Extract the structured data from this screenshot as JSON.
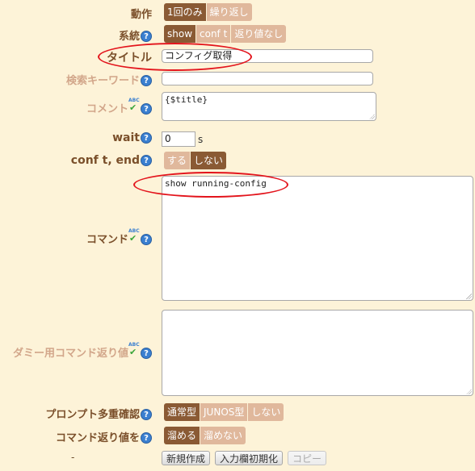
{
  "rows": {
    "action": {
      "label": "動作",
      "options": [
        "1回のみ",
        "繰り返し"
      ]
    },
    "system": {
      "label": "系統",
      "options": [
        "show",
        "conf t",
        "返り値なし"
      ]
    },
    "title": {
      "label": "タイトル",
      "value": "コンフィグ取得"
    },
    "search_keyword": {
      "label": "検索キーワード",
      "value": ""
    },
    "comment": {
      "label": "コメント",
      "value": "{$title}"
    },
    "wait": {
      "label": "wait",
      "value": "0",
      "unit": "s"
    },
    "conf_t_end": {
      "label": "conf t, end",
      "options": [
        "する",
        "しない"
      ]
    },
    "command": {
      "label": "コマンド",
      "value": "show running-config"
    },
    "dummy_return": {
      "label": "ダミー用コマンド返り値",
      "value": ""
    },
    "prompt_multi": {
      "label": "プロンプト多重確認",
      "options": [
        "通常型",
        "JUNOS型",
        "しない"
      ]
    },
    "command_return": {
      "label": "コマンド返り値を",
      "options": [
        "溜める",
        "溜めない"
      ]
    },
    "footer": {
      "label": "-",
      "buttons": [
        "新規作成",
        "入力欄初期化",
        "コピー"
      ]
    }
  },
  "icons": {
    "help": "?",
    "spellcheck_abc": "ABC",
    "spellcheck_check": "✔"
  },
  "colors": {
    "background": "#fdf3d8",
    "selected": "#8a5a34",
    "unselected": "#e0b89c",
    "highlight_oval": "#e3141c"
  }
}
